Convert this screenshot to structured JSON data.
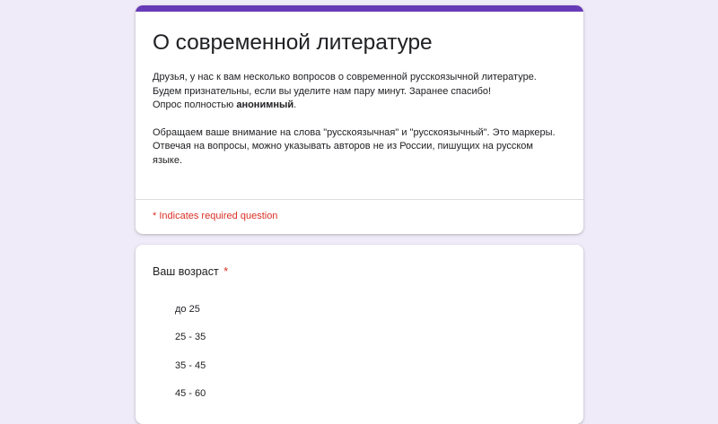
{
  "form": {
    "title": "О современной литературе",
    "description_p1_line1": "Друзья, у нас к вам несколько вопросов о современной русскоязычной литературе.",
    "description_p1_line2": "Будем признательны, если вы уделите нам пару минут. Заранее спасибо!",
    "description_p1_line3_prefix": "Опрос полностью ",
    "description_p1_line3_bold": "анонимный",
    "description_p1_line3_suffix": ".",
    "description_p2": "Обращаем ваше внимание на слова \"русскоязычная\" и \"русскоязычный\". Это маркеры. Отвечая на вопросы, можно указывать авторов не из России, пишущих на русском языке.",
    "required_note": "* Indicates required question",
    "accent_color": "#673ab7"
  },
  "question": {
    "title": "Ваш возраст",
    "required_mark": "*",
    "options": [
      "до 25",
      "25 - 35",
      "35 - 45",
      "45 - 60"
    ]
  }
}
